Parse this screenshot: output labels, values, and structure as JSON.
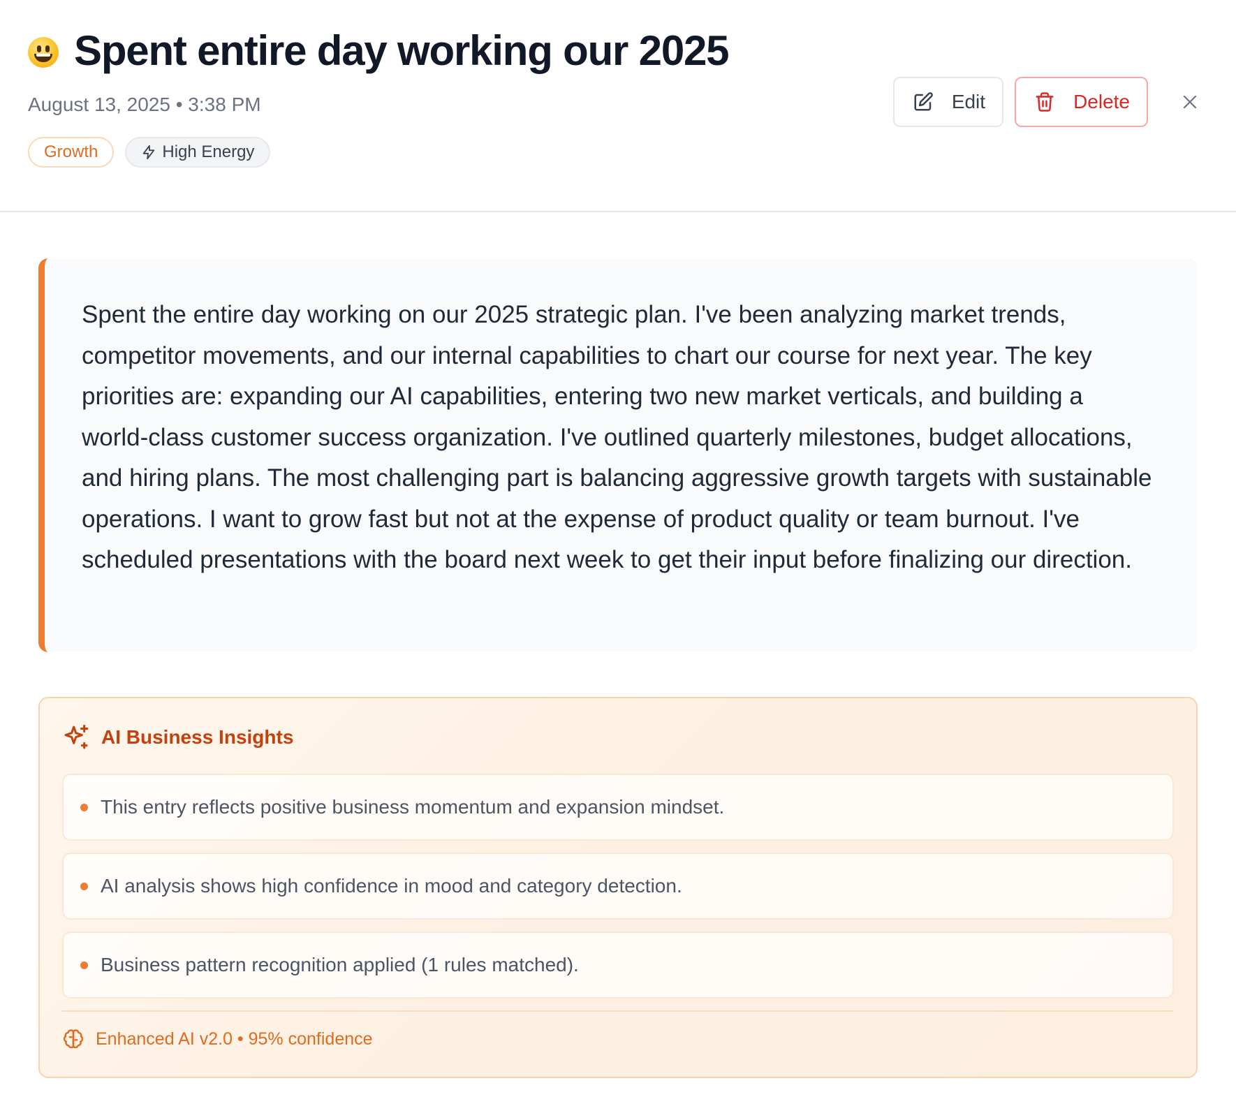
{
  "header": {
    "title": "Spent entire day working our 2025",
    "meta": "August 13, 2025 • 3:38 PM",
    "tags": {
      "category": "Growth",
      "energy": "High Energy"
    },
    "actions": {
      "edit_label": "Edit",
      "delete_label": "Delete"
    }
  },
  "entry": {
    "text": "Spent the entire day working on our 2025 strategic plan. I've been analyzing market trends, competitor movements, and our internal capabilities to chart our course for next year. The key priorities are: expanding our AI capabilities, entering two new market verticals, and building a world-class customer success organization. I've outlined quarterly milestones, budget allocations, and hiring plans. The most challenging part is balancing aggressive growth targets with sustainable operations. I want to grow fast but not at the expense of product quality or team burnout. I've scheduled presentations with the board next week to get their input before finalizing our direction."
  },
  "insights": {
    "title": "AI Business Insights",
    "items": [
      "This entry reflects positive business momentum and expansion mindset.",
      "AI analysis shows high confidence in mood and category detection.",
      "Business pattern recognition applied (1 rules matched)."
    ],
    "footer": "Enhanced AI v2.0 • 95% confidence"
  },
  "colors": {
    "accent": "#ed7d31",
    "danger": "#dc2626",
    "insight_title": "#c2410c"
  },
  "icons": {
    "mood": "smiley-emoji-icon",
    "energy": "lightning-icon",
    "edit": "edit-icon",
    "delete": "trash-icon",
    "close": "close-icon",
    "insights": "sparkles-icon",
    "footer": "brain-icon"
  }
}
